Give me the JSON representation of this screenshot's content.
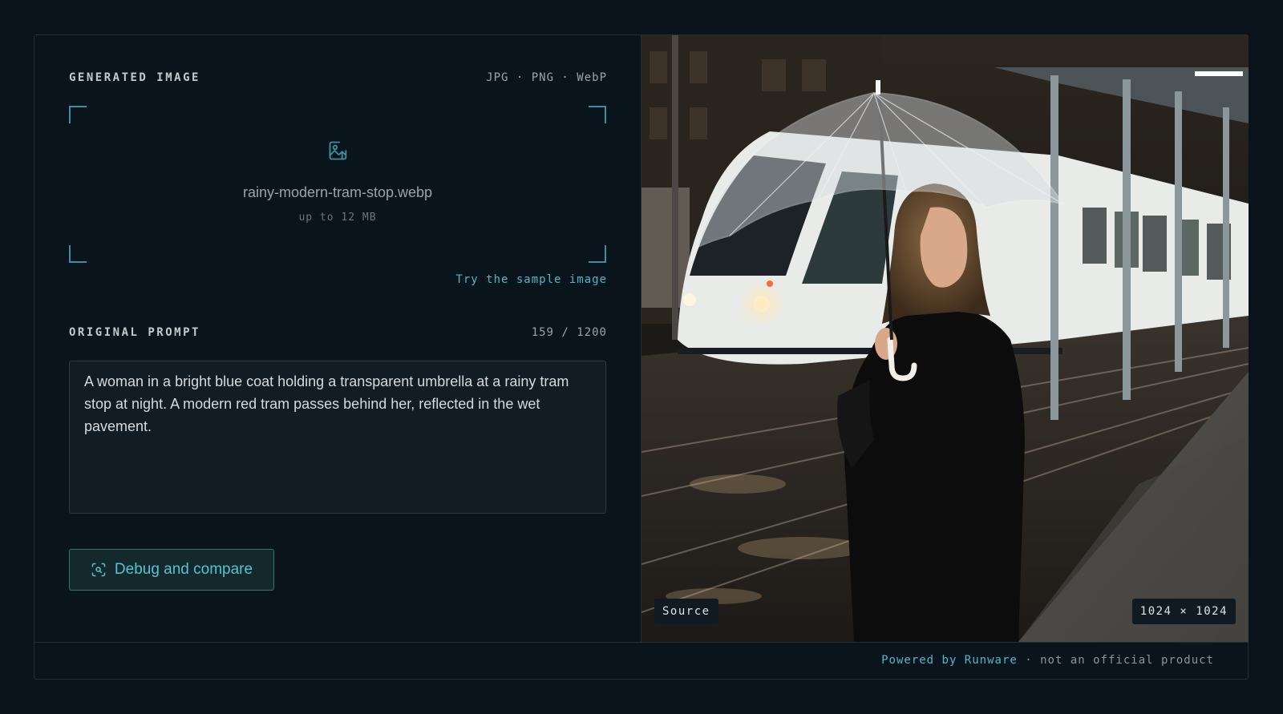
{
  "generated_image": {
    "label": "GENERATED IMAGE",
    "formats": "JPG · PNG · WebP",
    "file_name": "rainy-modern-tram-stop.webp",
    "size_limit": "up to 12 MB",
    "sample_link": "Try the sample image"
  },
  "original_prompt": {
    "label": "ORIGINAL PROMPT",
    "char_count": "159 / 1200",
    "text": "A woman in a bright blue coat holding a transparent umbrella at a rainy tram stop at night. A modern red tram passes behind her, reflected in the wet pavement."
  },
  "actions": {
    "debug_label": "Debug and compare"
  },
  "preview": {
    "source_badge": "Source",
    "dimensions": "1024 × 1024"
  },
  "footer": {
    "powered_by": "Powered by Runware",
    "separator": "·",
    "disclaimer": "not an official product"
  },
  "colors": {
    "accent": "#4fb8c2",
    "background": "#0a131b",
    "panel_border": "#243039"
  },
  "icons": {
    "drop": "image-upload-icon",
    "debug": "scan-search-icon"
  }
}
